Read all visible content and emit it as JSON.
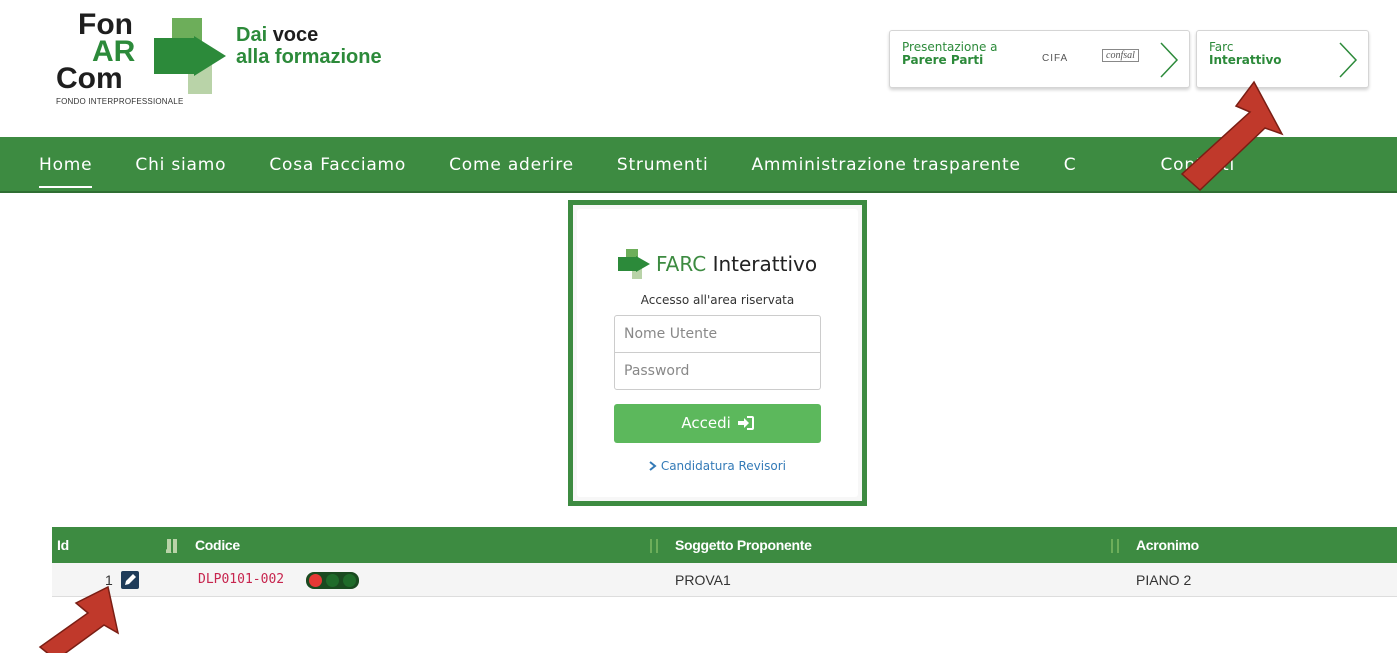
{
  "header": {
    "logo": {
      "line1": "Fon",
      "line2": "AR",
      "line3": "Com",
      "fondo": "FONDO INTERPROFESSIONALE",
      "tag_dai": "Dai",
      "tag_voce": "voce",
      "tag_line2": "alla formazione"
    },
    "btn_parere": {
      "line1": "Presentazione a",
      "line2": "Parere Parti",
      "partner1": "CIFA",
      "partner2": "confsal"
    },
    "btn_farc": {
      "line1": "Farc",
      "line2": "Interattivo"
    }
  },
  "nav": {
    "items": [
      {
        "label": "Home",
        "active": true
      },
      {
        "label": "Chi siamo"
      },
      {
        "label": "Cosa Facciamo"
      },
      {
        "label": "Come aderire"
      },
      {
        "label": "Strumenti"
      },
      {
        "label": "Amministrazione trasparente"
      },
      {
        "label": "C"
      },
      {
        "label": "Contatti"
      }
    ]
  },
  "login": {
    "brand_farc": "FARC",
    "brand_rest": " Interattivo",
    "subtitle": "Accesso all'area riservata",
    "username_placeholder": "Nome Utente",
    "password_placeholder": "Password",
    "submit_label": "Accedi",
    "link_label": "Candidatura Revisori"
  },
  "table": {
    "headers": {
      "id": "Id",
      "codice": "Codice",
      "soggetto": "Soggetto Proponente",
      "acronimo": "Acronimo"
    },
    "rows": [
      {
        "id": "1",
        "codice": "DLP0101-002",
        "soggetto": "PROVA1",
        "acronimo": "PIANO 2"
      }
    ]
  },
  "colors": {
    "brand_green": "#3d8b41",
    "button_green": "#5cb85c",
    "link_blue": "#337ab7",
    "code_red": "#c7254e",
    "annotation_arrow": "#c0392b"
  },
  "icons": [
    "chevron-right-icon",
    "sign-in-icon",
    "pencil-icon",
    "sort-icon",
    "traffic-light-icon",
    "farc-logo-icon"
  ]
}
